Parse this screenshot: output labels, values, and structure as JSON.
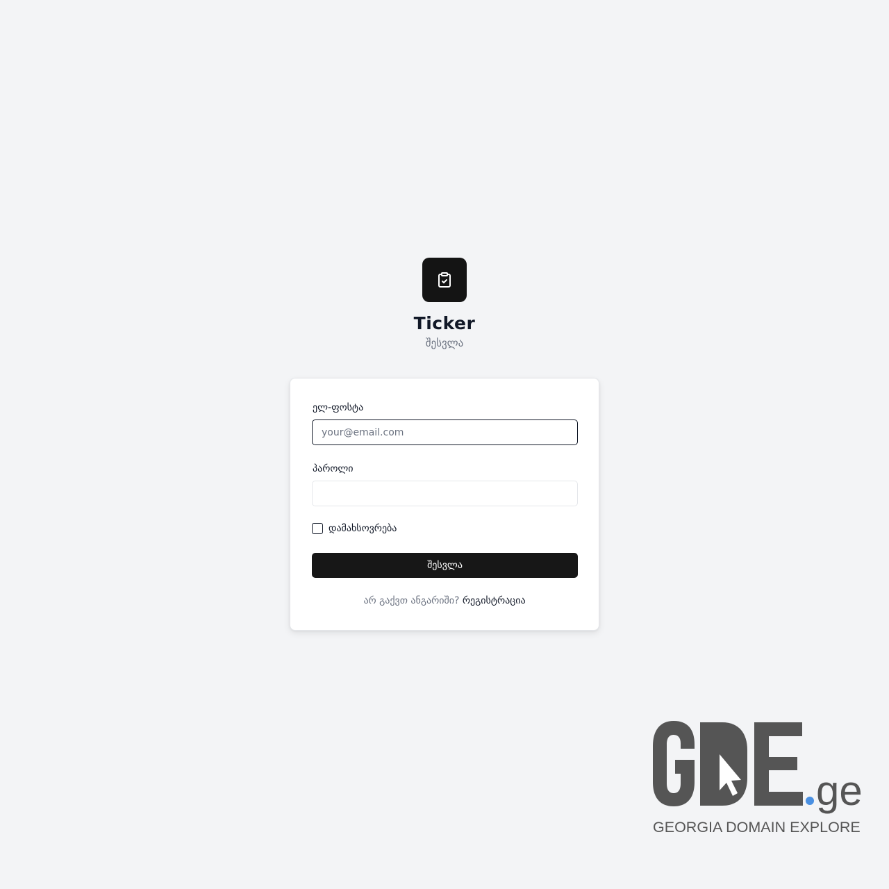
{
  "app": {
    "title": "Ticker",
    "subtitle": "შესვლა",
    "logo_icon": "clipboard-check-icon"
  },
  "form": {
    "email_label": "ელ-ფოსტა",
    "email_placeholder": "your@email.com",
    "email_value": "",
    "password_label": "პაროლი",
    "password_value": "",
    "remember_label": "დამახსოვრება",
    "remember_checked": false,
    "submit_label": "შესვლა",
    "signup_prompt": "არ გაქვთ ანგარიში?",
    "signup_link": "რეგისტრაცია"
  },
  "watermark": {
    "logo_text": "GDE.ge",
    "tagline": "GEORGIA DOMAIN EXPLORER"
  },
  "colors": {
    "background": "#f3f4f6",
    "primary": "#171717",
    "text": "#111827",
    "muted": "#6b7280",
    "watermark_gray": "#555555",
    "watermark_dot": "#4a90e2"
  }
}
